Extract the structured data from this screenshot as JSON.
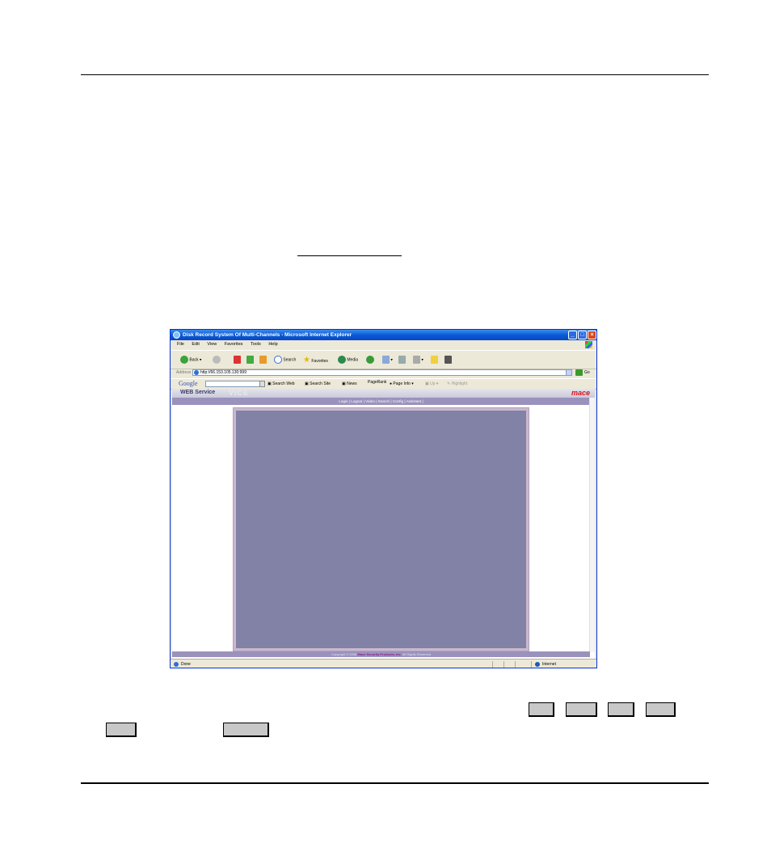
{
  "browser": {
    "window_title": "Disk Record System Of Multi-Channels - Microsoft Internet Explorer",
    "menu": [
      "File",
      "Edit",
      "View",
      "Favorites",
      "Tools",
      "Help"
    ],
    "toolbar": {
      "back": "Back",
      "search": "Search",
      "favorites": "Favorites",
      "media": "Media"
    },
    "address_label": "Address",
    "address_value": "http://66.153.105.130:999",
    "go_label": "Go",
    "google": {
      "logo": "Google",
      "search_web": "Search Web",
      "search_site": "Search Site",
      "news": "News",
      "pagerank": "PageRank",
      "page_info": "Page Info",
      "up": "Up",
      "highlight": "Highlight"
    },
    "status": "Done",
    "zone": "Internet"
  },
  "web_page": {
    "service_title": "WEB Service",
    "service_ghost": "VICE",
    "brand": "mace",
    "nav": [
      "Login",
      "Logout",
      "Video",
      "Search",
      "Config",
      "Assistant"
    ],
    "copyright_prefix": "Copyright © 2006",
    "copyright_company": "Mace Security Products, Inc.",
    "copyright_suffix": "All Rights Reserved"
  },
  "colors": {
    "stage": "#8281a6",
    "nav_bar": "#9a92bd",
    "brand": "#d8141c"
  }
}
